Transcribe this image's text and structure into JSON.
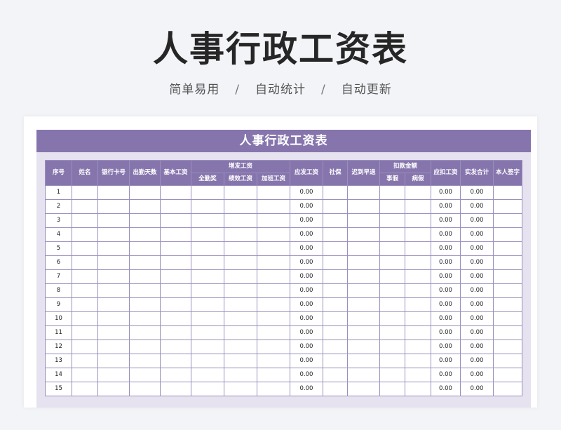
{
  "hero": {
    "title": "人事行政工资表",
    "features": [
      "简单易用",
      "自动统计",
      "自动更新"
    ],
    "separator": "/"
  },
  "sheet": {
    "title": "人事行政工资表",
    "headers": {
      "index": "序号",
      "name": "姓名",
      "bank_card": "银行卡号",
      "attendance_days": "出勤天数",
      "base_salary": "基本工资",
      "additions_group": "增发工资",
      "full_attendance_bonus": "全勤奖",
      "performance_pay": "绩效工资",
      "overtime_pay": "加班工资",
      "gross_pay": "应发工资",
      "social_security": "社保",
      "late_early": "迟到早退",
      "deductions_group": "扣款金额",
      "personal_leave": "事假",
      "sick_leave": "病假",
      "total_deductions": "应扣工资",
      "net_pay": "实发合计",
      "signature": "本人签字"
    },
    "rows": [
      {
        "index": "1",
        "gross_pay": "0.00",
        "total_deductions": "0.00",
        "net_pay": "0.00"
      },
      {
        "index": "2",
        "gross_pay": "0.00",
        "total_deductions": "0.00",
        "net_pay": "0.00"
      },
      {
        "index": "3",
        "gross_pay": "0.00",
        "total_deductions": "0.00",
        "net_pay": "0.00"
      },
      {
        "index": "4",
        "gross_pay": "0.00",
        "total_deductions": "0.00",
        "net_pay": "0.00"
      },
      {
        "index": "5",
        "gross_pay": "0.00",
        "total_deductions": "0.00",
        "net_pay": "0.00"
      },
      {
        "index": "6",
        "gross_pay": "0.00",
        "total_deductions": "0.00",
        "net_pay": "0.00"
      },
      {
        "index": "7",
        "gross_pay": "0.00",
        "total_deductions": "0.00",
        "net_pay": "0.00"
      },
      {
        "index": "8",
        "gross_pay": "0.00",
        "total_deductions": "0.00",
        "net_pay": "0.00"
      },
      {
        "index": "9",
        "gross_pay": "0.00",
        "total_deductions": "0.00",
        "net_pay": "0.00"
      },
      {
        "index": "10",
        "gross_pay": "0.00",
        "total_deductions": "0.00",
        "net_pay": "0.00"
      },
      {
        "index": "11",
        "gross_pay": "0.00",
        "total_deductions": "0.00",
        "net_pay": "0.00"
      },
      {
        "index": "12",
        "gross_pay": "0.00",
        "total_deductions": "0.00",
        "net_pay": "0.00"
      },
      {
        "index": "13",
        "gross_pay": "0.00",
        "total_deductions": "0.00",
        "net_pay": "0.00"
      },
      {
        "index": "14",
        "gross_pay": "0.00",
        "total_deductions": "0.00",
        "net_pay": "0.00"
      },
      {
        "index": "15",
        "gross_pay": "0.00",
        "total_deductions": "0.00",
        "net_pay": "0.00"
      }
    ]
  },
  "colors": {
    "header_purple": "#8675ad",
    "sheet_background": "#e6e2ef",
    "page_background": "#f3f4f8"
  }
}
